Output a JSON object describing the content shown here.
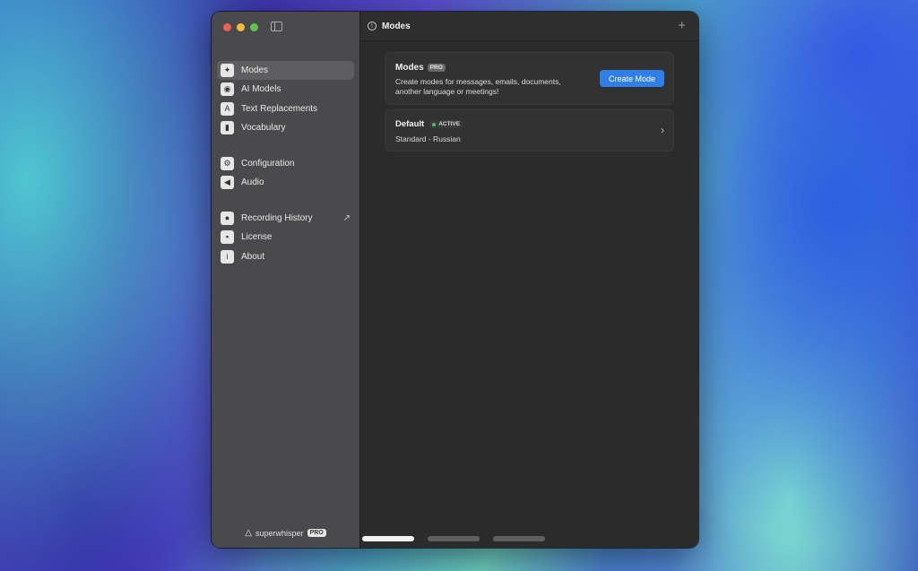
{
  "sidebar": {
    "groups": [
      [
        {
          "label": "Modes",
          "icon": "sparkle-icon",
          "glyph": "✦",
          "active": true
        },
        {
          "label": "AI Models",
          "icon": "chat-bubbles-icon",
          "glyph": "◉"
        },
        {
          "label": "Text Replacements",
          "icon": "text-replace-icon",
          "glyph": "A"
        },
        {
          "label": "Vocabulary",
          "icon": "book-icon",
          "glyph": "▮"
        }
      ],
      [
        {
          "label": "Configuration",
          "icon": "gear-icon",
          "glyph": "⚙"
        },
        {
          "label": "Audio",
          "icon": "speaker-icon",
          "glyph": "◀"
        }
      ],
      [
        {
          "label": "Recording History",
          "icon": "clock-icon",
          "glyph": "●",
          "external": true
        },
        {
          "label": "License",
          "icon": "license-icon",
          "glyph": "▪"
        },
        {
          "label": "About",
          "icon": "info-icon",
          "glyph": "i"
        }
      ]
    ],
    "brand_name": "superwhisper",
    "brand_badge": "PRO"
  },
  "header": {
    "title": "Modes"
  },
  "intro_card": {
    "title": "Modes",
    "badge": "PRO",
    "description": "Create modes for messages, emails, documents, another language or meetings!",
    "button_label": "Create Mode"
  },
  "mode_card": {
    "title": "Default",
    "status": "ACTIVE",
    "subtitle": "Standard - Russian"
  },
  "colors": {
    "accent": "#2f7fe6",
    "active_dot": "#4cc25a"
  }
}
